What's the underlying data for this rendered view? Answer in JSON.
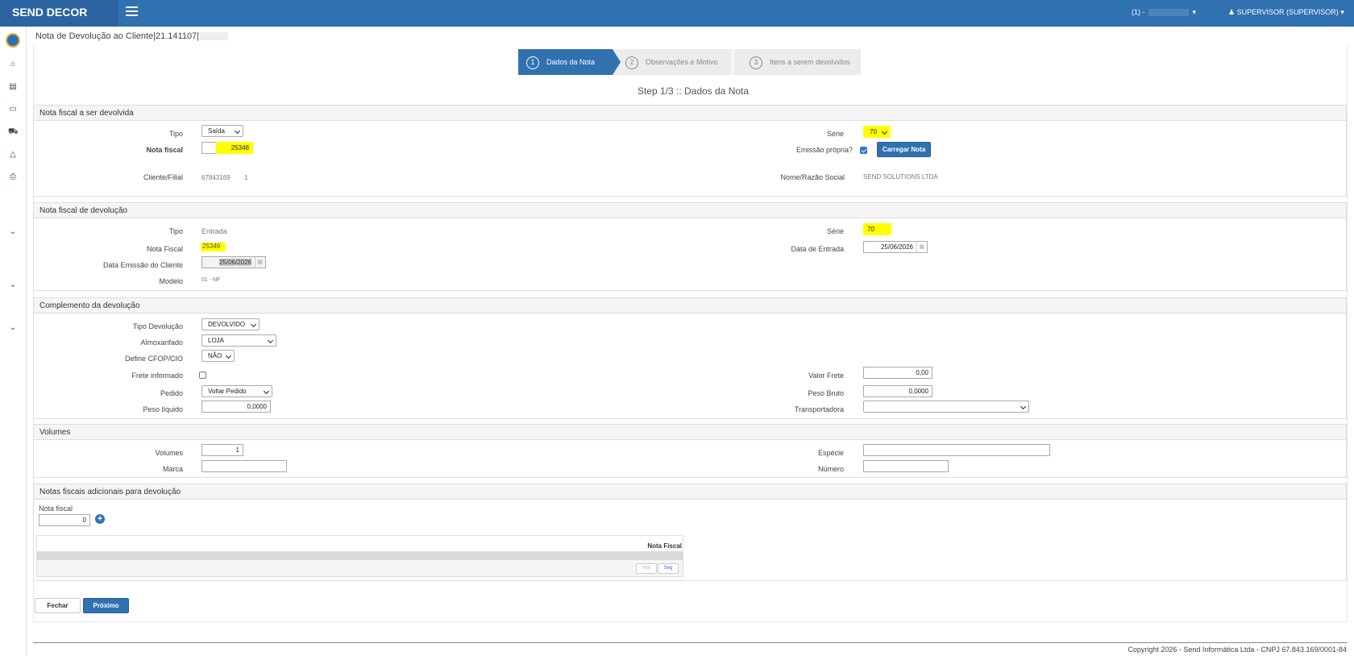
{
  "topbar": {
    "brand": "SEND DECOR",
    "selector": "(1) -",
    "user": "SUPERVISOR (SUPERVISOR)"
  },
  "page": {
    "title": "Nota de Devolução ao Cliente|21.141107|"
  },
  "steps": [
    {
      "num": "1",
      "label": "Dados da Nota",
      "active": true
    },
    {
      "num": "2",
      "label": "Observações e Motivo",
      "active": false
    },
    {
      "num": "3",
      "label": "Itens a serem devolvidos",
      "active": false
    }
  ],
  "step_title": "Step 1/3 :: Dados da Nota",
  "nf_devolvida": {
    "header": "Nota fiscal a ser devolvida",
    "tipo_label": "Tipo",
    "tipo_value": "Saída",
    "serie_label": "Série",
    "serie_value": "70",
    "nota_label": "Nota fiscal",
    "nota_value": "25348",
    "emissao_label": "Emissão própria?",
    "carregar_label": "Carregar Nota",
    "cliente_label": "Cliente/Filial",
    "cliente_value": "67843169",
    "filial_value": "1",
    "nome_label": "Nome/Razão Social",
    "nome_value": "SEND SOLUTIONS LTDA"
  },
  "nf_devolucao": {
    "header": "Nota fiscal de devolução",
    "tipo_label": "Tipo",
    "tipo_value": "Entrada",
    "serie_label": "Série",
    "serie_value": "70",
    "nota_label": "Nota Fiscal",
    "nota_value": "25349",
    "data_entrada_label": "Data de Entrada",
    "data_entrada_value": "25/06/2026",
    "data_emissao_label": "Data Emissão do Cliente",
    "data_emissao_value": "25/06/2026",
    "modelo_label": "Modelo",
    "modelo_value": "01 - NF"
  },
  "complemento": {
    "header": "Complemento da devolução",
    "tipo_dev_label": "Tipo Devolução",
    "tipo_dev_value": "DEVOLVIDO",
    "almox_label": "Almoxarifado",
    "almox_value": "LOJA",
    "cfop_label": "Define CFOP/CIO",
    "cfop_value": "NÃO",
    "frete_inf_label": "Frete informado",
    "valor_frete_label": "Valor Frete",
    "valor_frete_value": "0,00",
    "pedido_label": "Pedido",
    "pedido_value": "Voltar Pedido",
    "peso_bruto_label": "Peso Bruto",
    "peso_bruto_value": "0,0000",
    "peso_liq_label": "Peso líquido",
    "peso_liq_value": "0,0000",
    "transp_label": "Transportadora"
  },
  "volumes": {
    "header": "Volumes",
    "volumes_label": "Volumes",
    "volumes_value": "1",
    "especie_label": "Espécie",
    "marca_label": "Marca",
    "numero_label": "Número"
  },
  "adicionais": {
    "header": "Notas fiscais adicionais para devolução",
    "nota_label": "Nota fiscal",
    "nota_value": "0",
    "grid_col": "Nota Fiscal",
    "prev_label": "Ant",
    "next_label": "Seg"
  },
  "actions": {
    "fechar": "Fechar",
    "proximo": "Próximo"
  },
  "footer": {
    "copyright": "Copyright 2026 - Send Informática Ltda - CNPJ 67.843.169/0001-84"
  }
}
